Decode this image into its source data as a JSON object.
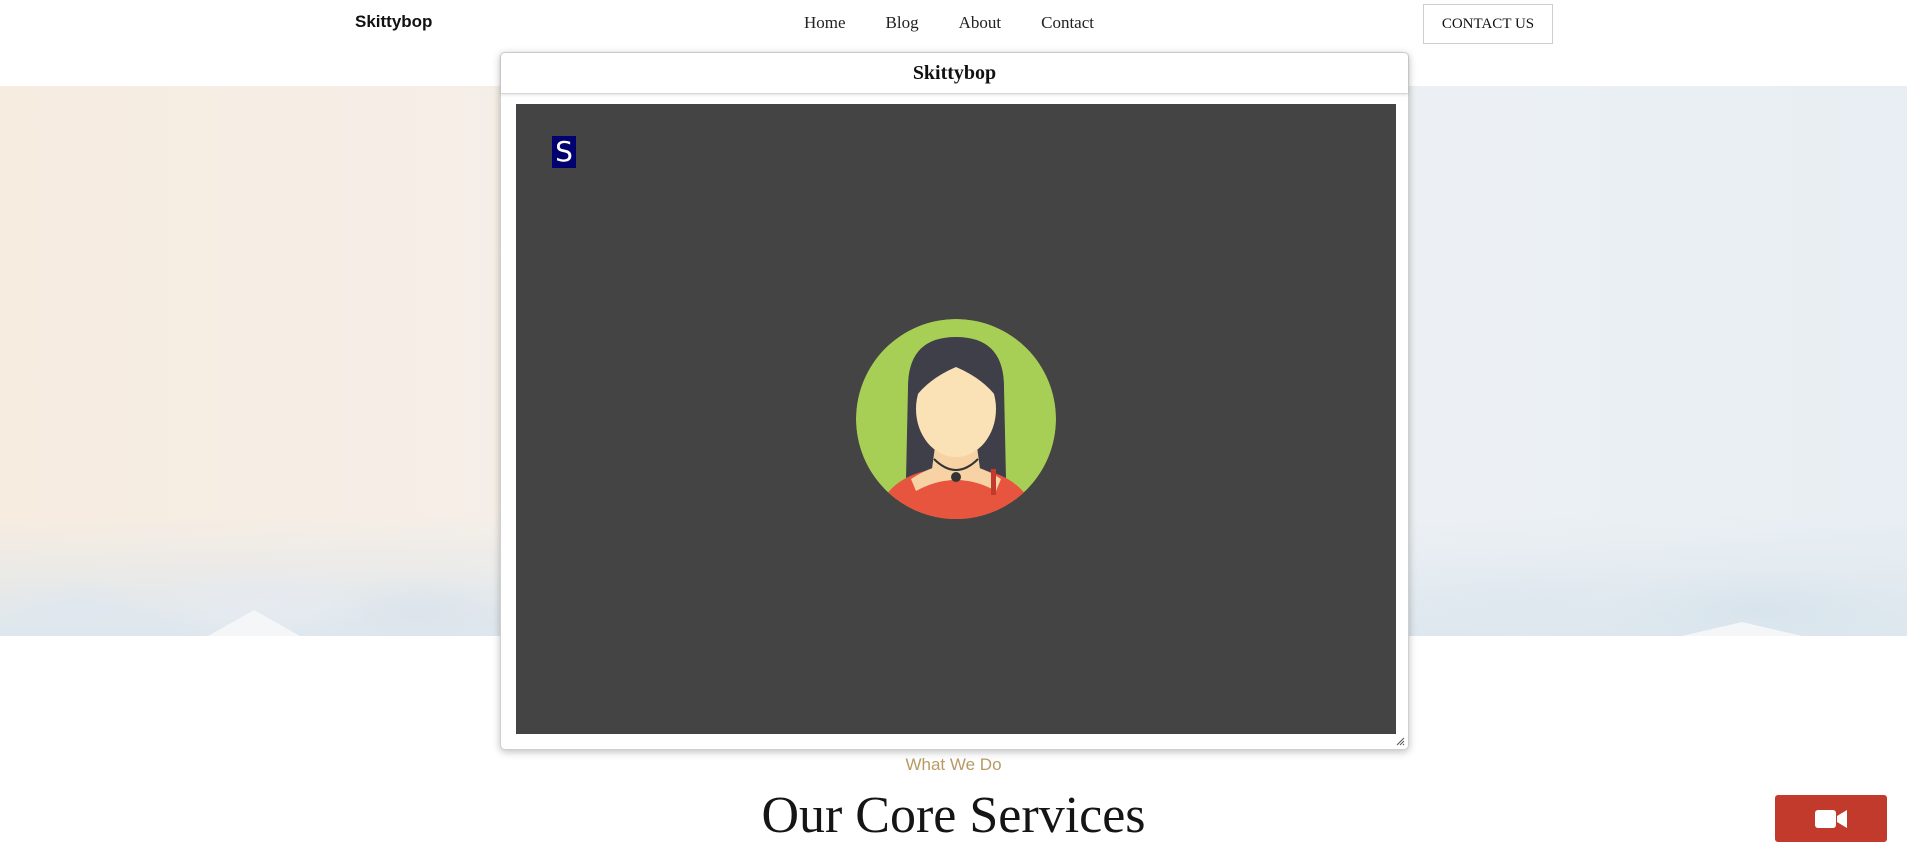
{
  "header": {
    "brand": "Skittybop",
    "nav": [
      "Home",
      "Blog",
      "About",
      "Contact"
    ],
    "contact_button": "CONTACT US"
  },
  "section": {
    "kicker": "What We Do",
    "title": "Our Core Services"
  },
  "call_window": {
    "title": "Skittybop",
    "participant_initial": "S",
    "avatar_icon": "female-avatar-icon",
    "resize_icon": "resize-grip-icon"
  },
  "floating_button": {
    "icon": "video-camera-icon"
  },
  "colors": {
    "video_background": "#444444",
    "initial_badge": "#00006e",
    "avatar_background": "#a8cf55",
    "accent_gold": "#b89a63",
    "video_button": "#c23a2b"
  }
}
